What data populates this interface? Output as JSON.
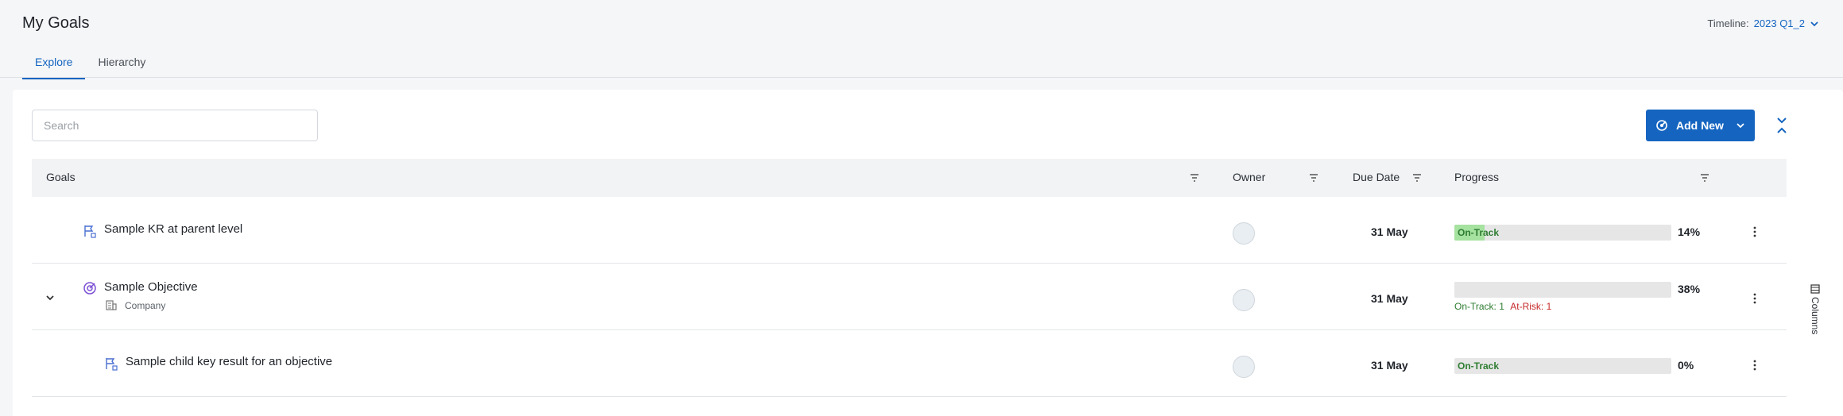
{
  "page": {
    "title": "My Goals",
    "timeline_label": "Timeline:",
    "timeline_value": "2023 Q1_2"
  },
  "tabs": [
    {
      "label": "Explore",
      "active": true
    },
    {
      "label": "Hierarchy",
      "active": false
    }
  ],
  "toolbar": {
    "search_placeholder": "Search",
    "add_new_label": "Add New"
  },
  "table": {
    "headers": {
      "goals": "Goals",
      "owner": "Owner",
      "due_date": "Due Date",
      "progress": "Progress"
    },
    "rows": [
      {
        "title": "Sample KR at parent level",
        "icon": "key-result-flag-icon",
        "due": "31 May",
        "status": "On-Track",
        "progress_fraction": 0.14,
        "percent": "14%"
      },
      {
        "title": "Sample Objective",
        "icon": "objective-target-icon",
        "subtitle": "Company",
        "due": "31 May",
        "progress_fraction": 0.38,
        "percent": "38%",
        "counts": {
          "on_track": "On-Track: 1",
          "at_risk": "At-Risk: 1"
        }
      },
      {
        "title": "Sample child key result for an objective",
        "icon": "key-result-flag-icon",
        "due": "31 May",
        "status": "On-Track",
        "progress_fraction": 0.0,
        "percent": "0%"
      }
    ]
  },
  "columns_label": "Columns",
  "colors": {
    "accent": "#1565c0",
    "on_track": "#2e7d32",
    "at_risk": "#c62828",
    "progress_fill": "#a6e2a0"
  }
}
